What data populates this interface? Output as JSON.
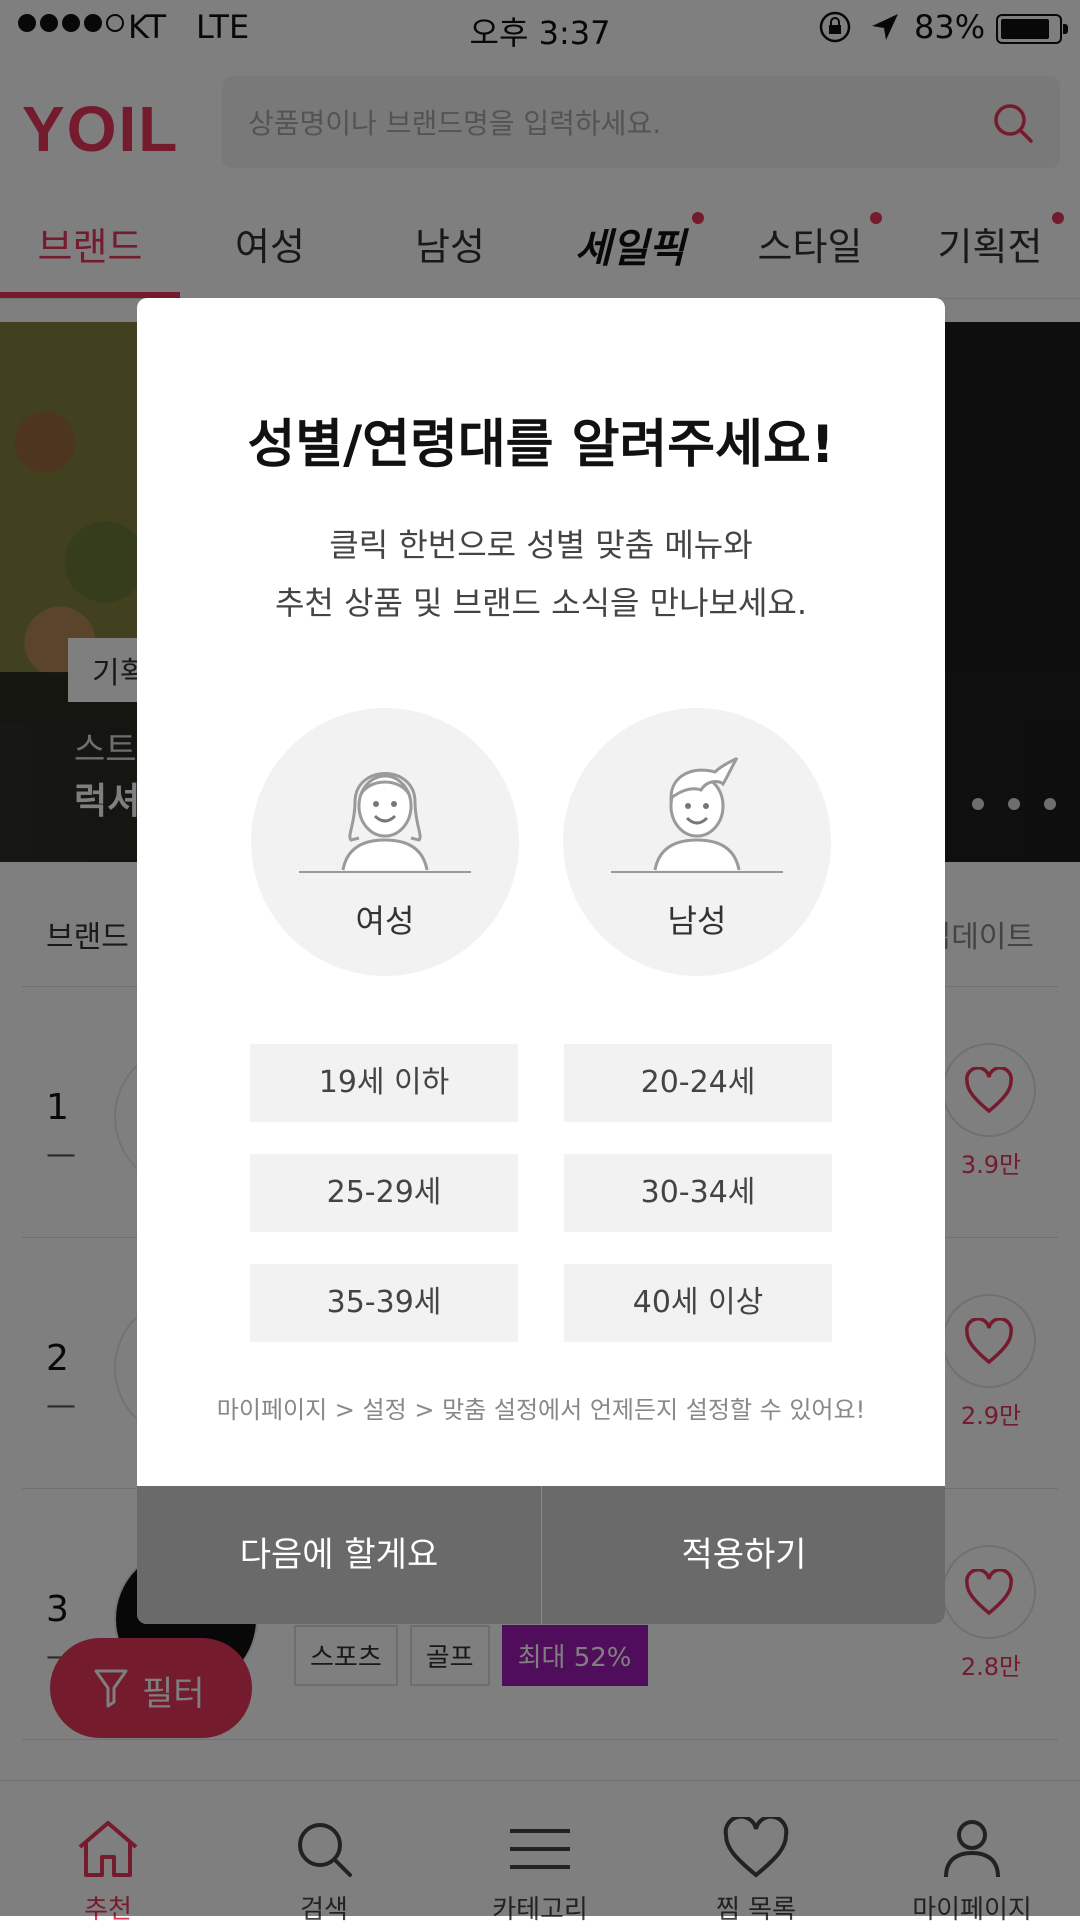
{
  "status_bar": {
    "carrier": "KT",
    "network": "LTE",
    "time": "오후 3:37",
    "battery": "83%"
  },
  "header": {
    "logo": "YOIL",
    "search_placeholder": "상품명이나 브랜드명을 입력하세요."
  },
  "tabs": [
    {
      "label": "브랜드",
      "active": true
    },
    {
      "label": "여성"
    },
    {
      "label": "남성"
    },
    {
      "label": "세일픽",
      "dot": true
    },
    {
      "label": "스타일",
      "dot": true
    },
    {
      "label": "기획전",
      "dot": true
    }
  ],
  "banner": {
    "tag": "기획",
    "subtitle": "스트",
    "title": "럭셔"
  },
  "ranking": {
    "header": "브랜드",
    "update": "업데이트",
    "rows": [
      {
        "rank": "1",
        "change": "—",
        "likes": "3.9만"
      },
      {
        "rank": "2",
        "change": "—",
        "likes": "2.9만"
      },
      {
        "rank": "3",
        "change": "—",
        "likes": "2.8만",
        "chips": [
          "스포츠",
          "골프",
          "최대 52%"
        ]
      }
    ]
  },
  "filter_button": "필터",
  "bottom_nav": [
    {
      "label": "추천",
      "icon": "home-icon",
      "active": true
    },
    {
      "label": "검색",
      "icon": "search-icon"
    },
    {
      "label": "카테고리",
      "icon": "menu-icon"
    },
    {
      "label": "찜 목록",
      "icon": "heart-icon"
    },
    {
      "label": "마이페이지",
      "icon": "user-icon"
    }
  ],
  "modal": {
    "title": "성별/연령대를 알려주세요!",
    "desc_line1": "클릭 한번으로 성별 맞춤 메뉴와",
    "desc_line2": "추천 상품 및 브랜드 소식을 만나보세요.",
    "gender_female": "여성",
    "gender_male": "남성",
    "ages": [
      "19세 이하",
      "20-24세",
      "25-29세",
      "30-34세",
      "35-39세",
      "40세 이상"
    ],
    "note": "마이페이지 > 설정 > 맞춤 설정에서 언제든지 설정할 수 있어요!",
    "later": "다음에 할게요",
    "apply": "적용하기"
  },
  "colors": {
    "accent": "#e8365a",
    "sale_chip": "#a01bb7"
  }
}
